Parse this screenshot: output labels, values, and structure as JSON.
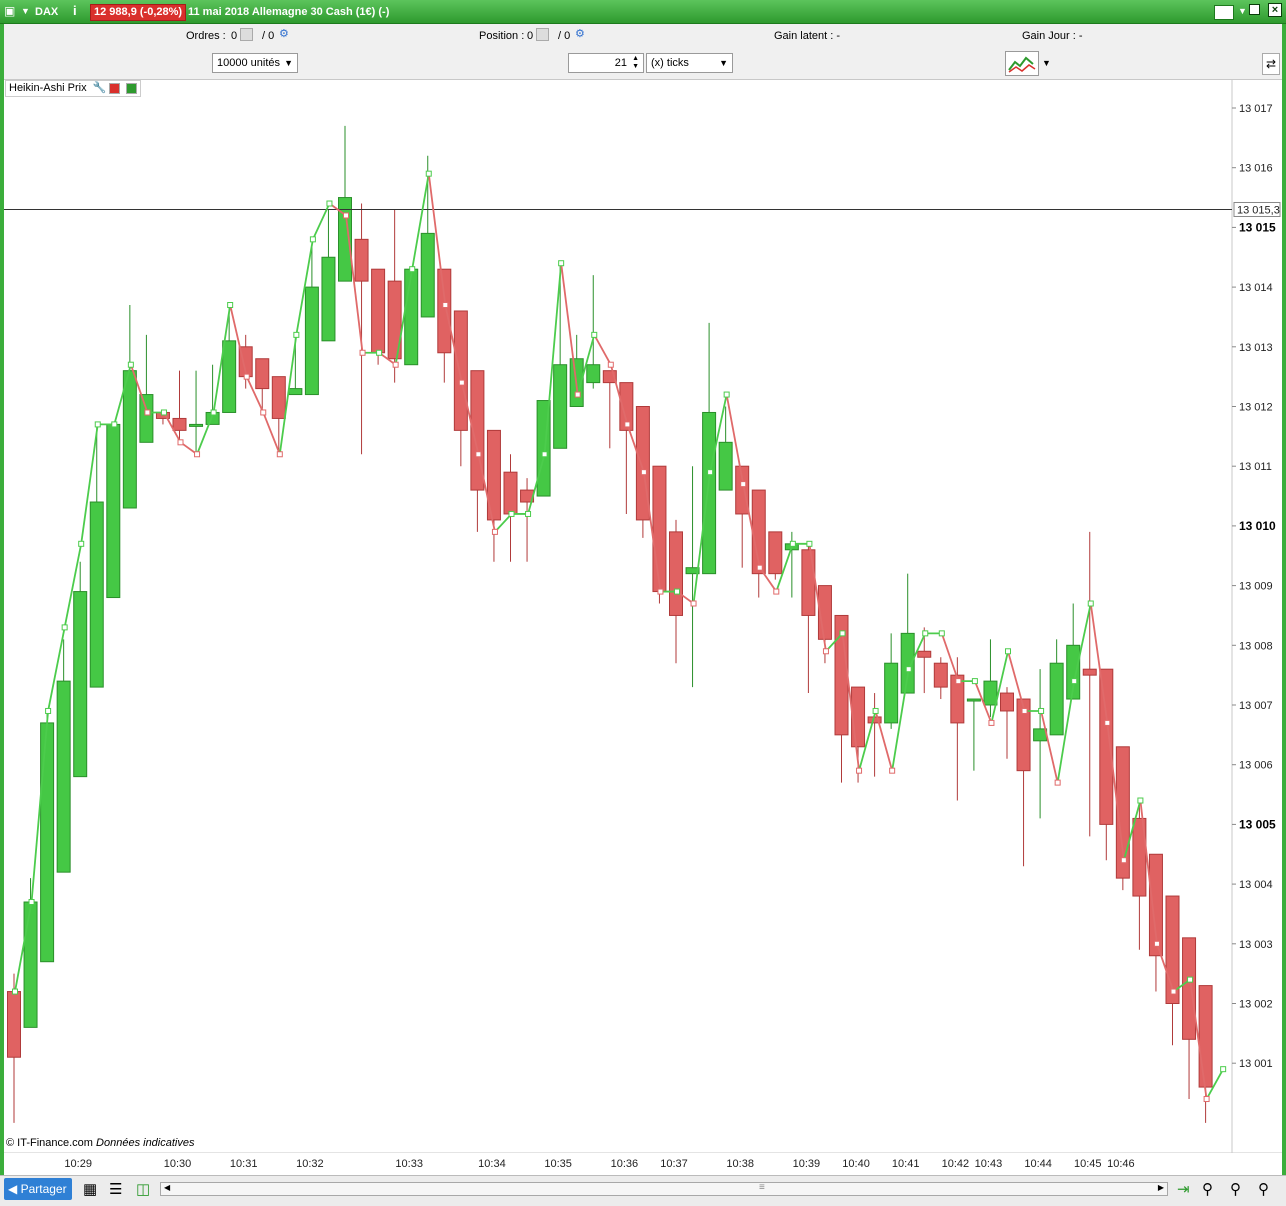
{
  "window": {
    "symbol": "DAX",
    "price_badge": "12 988,9 (-0,28%)",
    "title": "11 mai 2018 Allemagne 30 Cash (1€) (-)",
    "info_icon": "info-icon"
  },
  "toolbar": {
    "orders_label": "Ordres :",
    "orders_value": "0",
    "orders_sep": "/ 0",
    "position_label": "Position :",
    "position_value": "0",
    "position_sep": "/ 0",
    "gain_latent": "Gain latent :  -",
    "gain_jour": "Gain Jour :  -",
    "units_select": "10000 unités",
    "ticks_value": "21",
    "ticks_select": "(x) ticks"
  },
  "indicator": {
    "label": "Heikin-Ashi Prix"
  },
  "watermark": {
    "copyright": "© IT-Finance.com",
    "note": "Données indicatives"
  },
  "current_price_label": "13 015,3",
  "bottom": {
    "share_label": "Partager"
  },
  "colors": {
    "up": "#45c845",
    "down": "#e06262",
    "frame": "#3bae3b",
    "line_up": "#4ccc4c",
    "line_down": "#e06a6a"
  },
  "chart_data": {
    "type": "candlestick-heikin-ashi",
    "ylim": [
      13000,
      13017.5
    ],
    "current_price": 13015.3,
    "yticks": [
      {
        "v": 13017,
        "label": "13 017",
        "bold": false
      },
      {
        "v": 13016,
        "label": "13 016",
        "bold": false
      },
      {
        "v": 13015,
        "label": "13 015",
        "bold": true
      },
      {
        "v": 13014,
        "label": "13 014",
        "bold": false
      },
      {
        "v": 13013,
        "label": "13 013",
        "bold": false
      },
      {
        "v": 13012,
        "label": "13 012",
        "bold": false
      },
      {
        "v": 13011,
        "label": "13 011",
        "bold": false
      },
      {
        "v": 13010,
        "label": "13 010",
        "bold": true
      },
      {
        "v": 13009,
        "label": "13 009",
        "bold": false
      },
      {
        "v": 13008,
        "label": "13 008",
        "bold": false
      },
      {
        "v": 13007,
        "label": "13 007",
        "bold": false
      },
      {
        "v": 13006,
        "label": "13 006",
        "bold": false
      },
      {
        "v": 13005,
        "label": "13 005",
        "bold": true
      },
      {
        "v": 13004,
        "label": "13 004",
        "bold": false
      },
      {
        "v": 13003,
        "label": "13 003",
        "bold": false
      },
      {
        "v": 13002,
        "label": "13 002",
        "bold": false
      },
      {
        "v": 13001,
        "label": "13 001",
        "bold": false
      }
    ],
    "xticks": [
      {
        "i": 4,
        "label": "10:29"
      },
      {
        "i": 10,
        "label": "10:30"
      },
      {
        "i": 14,
        "label": "10:31"
      },
      {
        "i": 18,
        "label": "10:32"
      },
      {
        "i": 24,
        "label": "10:33"
      },
      {
        "i": 29,
        "label": "10:34"
      },
      {
        "i": 33,
        "label": "10:35"
      },
      {
        "i": 37,
        "label": "10:36"
      },
      {
        "i": 40,
        "label": "10:37"
      },
      {
        "i": 44,
        "label": "10:38"
      },
      {
        "i": 48,
        "label": "10:39"
      },
      {
        "i": 51,
        "label": "10:40"
      },
      {
        "i": 54,
        "label": "10:41"
      },
      {
        "i": 57,
        "label": "10:42"
      },
      {
        "i": 59,
        "label": "10:43"
      },
      {
        "i": 62,
        "label": "10:44"
      },
      {
        "i": 65,
        "label": "10:45"
      },
      {
        "i": 67,
        "label": "10:46"
      }
    ],
    "candles": [
      {
        "o": 13002.2,
        "c": 13001.1,
        "h": 13002.5,
        "l": 13000
      },
      {
        "o": 13001.6,
        "c": 13003.7,
        "h": 13004.1,
        "l": 13001.6
      },
      {
        "o": 13002.7,
        "c": 13006.7,
        "h": 13006.9,
        "l": 13002.7
      },
      {
        "o": 13004.2,
        "c": 13007.4,
        "h": 13008.1,
        "l": 13004.2
      },
      {
        "o": 13005.8,
        "c": 13008.9,
        "h": 13009.4,
        "l": 13005.8
      },
      {
        "o": 13007.3,
        "c": 13010.4,
        "h": 13011.7,
        "l": 13007.3
      },
      {
        "o": 13008.8,
        "c": 13011.7,
        "h": 13011.7,
        "l": 13008.8
      },
      {
        "o": 13010.3,
        "c": 13012.6,
        "h": 13013.7,
        "l": 13010.3
      },
      {
        "o": 13011.4,
        "c": 13012.2,
        "h": 13013.2,
        "l": 13011.4
      },
      {
        "o": 13011.9,
        "c": 13011.8,
        "h": 13011.9,
        "l": 13011.7
      },
      {
        "o": 13011.8,
        "c": 13011.6,
        "h": 13012.6,
        "l": 13011.4
      },
      {
        "o": 13011.7,
        "c": 13011.7,
        "h": 13012.6,
        "l": 13011.2
      },
      {
        "o": 13011.7,
        "c": 13011.9,
        "h": 13012.7,
        "l": 13011.7
      },
      {
        "o": 13011.9,
        "c": 13013.1,
        "h": 13013.7,
        "l": 13011.9
      },
      {
        "o": 13013.0,
        "c": 13012.5,
        "h": 13013.2,
        "l": 13012.3
      },
      {
        "o": 13012.8,
        "c": 13012.3,
        "h": 13012.8,
        "l": 13011.9
      },
      {
        "o": 13012.5,
        "c": 13011.8,
        "h": 13012.5,
        "l": 13011.2
      },
      {
        "o": 13012.2,
        "c": 13012.3,
        "h": 13013.2,
        "l": 13012.2
      },
      {
        "o": 13012.2,
        "c": 13014.0,
        "h": 13014.7,
        "l": 13012.2
      },
      {
        "o": 13013.1,
        "c": 13014.5,
        "h": 13015.3,
        "l": 13013.1
      },
      {
        "o": 13014.1,
        "c": 13015.5,
        "h": 13016.7,
        "l": 13014.1
      },
      {
        "o": 13014.8,
        "c": 13014.1,
        "h": 13015.4,
        "l": 13011.2
      },
      {
        "o": 13014.3,
        "c": 13012.9,
        "h": 13014.3,
        "l": 13012.7
      },
      {
        "o": 13014.1,
        "c": 13012.8,
        "h": 13015.3,
        "l": 13012.4
      },
      {
        "o": 13012.7,
        "c": 13014.3,
        "h": 13014.3,
        "l": 13012.7
      },
      {
        "o": 13013.5,
        "c": 13014.9,
        "h": 13016.2,
        "l": 13013.5
      },
      {
        "o": 13014.3,
        "c": 13012.9,
        "h": 13014.3,
        "l": 13012.4
      },
      {
        "o": 13013.6,
        "c": 13011.6,
        "h": 13013.6,
        "l": 13011.0
      },
      {
        "o": 13012.6,
        "c": 13010.6,
        "h": 13012.6,
        "l": 13009.9
      },
      {
        "o": 13011.6,
        "c": 13010.1,
        "h": 13011.6,
        "l": 13009.4
      },
      {
        "o": 13010.9,
        "c": 13010.2,
        "h": 13011.2,
        "l": 13009.4
      },
      {
        "o": 13010.6,
        "c": 13010.4,
        "h": 13010.8,
        "l": 13009.4
      },
      {
        "o": 13010.5,
        "c": 13012.1,
        "h": 13012.1,
        "l": 13010.5
      },
      {
        "o": 13011.3,
        "c": 13012.7,
        "h": 13014.4,
        "l": 13011.3
      },
      {
        "o": 13012.0,
        "c": 13012.8,
        "h": 13013.2,
        "l": 13012.0
      },
      {
        "o": 13012.4,
        "c": 13012.7,
        "h": 13014.2,
        "l": 13012.3
      },
      {
        "o": 13012.6,
        "c": 13012.4,
        "h": 13012.6,
        "l": 13011.3
      },
      {
        "o": 13012.4,
        "c": 13011.6,
        "h": 13012.4,
        "l": 13010.2
      },
      {
        "o": 13012.0,
        "c": 13010.1,
        "h": 13012.0,
        "l": 13009.8
      },
      {
        "o": 13011.0,
        "c": 13008.9,
        "h": 13011.0,
        "l": 13008.7
      },
      {
        "o": 13009.9,
        "c": 13008.5,
        "h": 13010.1,
        "l": 13007.7
      },
      {
        "o": 13009.2,
        "c": 13009.3,
        "h": 13011.0,
        "l": 13007.3
      },
      {
        "o": 13009.2,
        "c": 13011.9,
        "h": 13013.4,
        "l": 13009.2
      },
      {
        "o": 13010.6,
        "c": 13011.4,
        "h": 13012.0,
        "l": 13010.6
      },
      {
        "o": 13011.0,
        "c": 13010.2,
        "h": 13011.0,
        "l": 13009.3
      },
      {
        "o": 13010.6,
        "c": 13009.2,
        "h": 13010.6,
        "l": 13008.8
      },
      {
        "o": 13009.9,
        "c": 13009.2,
        "h": 13009.9,
        "l": 13009.1
      },
      {
        "o": 13009.6,
        "c": 13009.7,
        "h": 13009.9,
        "l": 13008.8
      },
      {
        "o": 13009.6,
        "c": 13008.5,
        "h": 13009.7,
        "l": 13007.2
      },
      {
        "o": 13009.0,
        "c": 13008.1,
        "h": 13009.0,
        "l": 13007.7
      },
      {
        "o": 13008.5,
        "c": 13006.5,
        "h": 13008.5,
        "l": 13005.7
      },
      {
        "o": 13007.3,
        "c": 13006.3,
        "h": 13007.3,
        "l": 13005.7
      },
      {
        "o": 13006.8,
        "c": 13006.7,
        "h": 13007.2,
        "l": 13005.8
      },
      {
        "o": 13006.7,
        "c": 13007.7,
        "h": 13008.2,
        "l": 13006.6
      },
      {
        "o": 13007.2,
        "c": 13008.2,
        "h": 13009.2,
        "l": 13007.2
      },
      {
        "o": 13007.9,
        "c": 13007.8,
        "h": 13008.3,
        "l": 13007.2
      },
      {
        "o": 13007.7,
        "c": 13007.3,
        "h": 13007.8,
        "l": 13007.1
      },
      {
        "o": 13007.5,
        "c": 13006.7,
        "h": 13007.8,
        "l": 13005.4
      },
      {
        "o": 13007.1,
        "c": 13007.1,
        "h": 13007.1,
        "l": 13005.9
      },
      {
        "o": 13007.0,
        "c": 13007.4,
        "h": 13008.1,
        "l": 13006.8
      },
      {
        "o": 13007.2,
        "c": 13006.9,
        "h": 13007.3,
        "l": 13006.1
      },
      {
        "o": 13007.1,
        "c": 13005.9,
        "h": 13007.1,
        "l": 13004.3
      },
      {
        "o": 13006.4,
        "c": 13006.6,
        "h": 13007.6,
        "l": 13005.1
      },
      {
        "o": 13006.5,
        "c": 13007.7,
        "h": 13008.1,
        "l": 13006.5
      },
      {
        "o": 13007.1,
        "c": 13008.0,
        "h": 13008.7,
        "l": 13007.1
      },
      {
        "o": 13007.6,
        "c": 13007.5,
        "h": 13009.9,
        "l": 13004.8
      },
      {
        "o": 13007.6,
        "c": 13005.0,
        "h": 13007.6,
        "l": 13004.4
      },
      {
        "o": 13006.3,
        "c": 13004.1,
        "h": 13006.3,
        "l": 13003.9
      },
      {
        "o": 13005.1,
        "c": 13003.8,
        "h": 13005.4,
        "l": 13002.9
      },
      {
        "o": 13004.5,
        "c": 13002.8,
        "h": 13004.5,
        "l": 13002.2
      },
      {
        "o": 13003.8,
        "c": 13002.0,
        "h": 13003.8,
        "l": 13001.3
      },
      {
        "o": 13003.1,
        "c": 13001.4,
        "h": 13003.1,
        "l": 13000.4
      },
      {
        "o": 13002.3,
        "c": 13000.6,
        "h": 13002.3,
        "l": 13000.0
      }
    ],
    "line_points": [
      13002.2,
      13003.7,
      13006.9,
      13008.3,
      13009.7,
      13011.7,
      13011.7,
      13012.7,
      13011.9,
      13011.9,
      13011.4,
      13011.2,
      13011.9,
      13013.7,
      13012.5,
      13011.9,
      13011.2,
      13013.2,
      13014.8,
      13015.4,
      13015.2,
      13012.9,
      13012.9,
      13012.7,
      13014.3,
      13015.9,
      13013.7,
      13012.4,
      13011.2,
      13009.9,
      13010.2,
      13010.2,
      13011.2,
      13014.4,
      13012.2,
      13013.2,
      13012.7,
      13011.7,
      13010.9,
      13008.9,
      13008.9,
      13008.7,
      13010.9,
      13012.2,
      13010.7,
      13009.3,
      13008.9,
      13009.7,
      13009.7,
      13007.9,
      13008.2,
      13005.9,
      13006.9,
      13005.9,
      13007.6,
      13008.2,
      13008.2,
      13007.4,
      13007.4,
      13006.7,
      13007.9,
      13006.9,
      13006.9,
      13005.7,
      13007.4,
      13008.7,
      13006.7,
      13004.4,
      13005.4,
      13003.0,
      13002.2,
      13002.4,
      13000.4,
      13000.9
    ]
  }
}
